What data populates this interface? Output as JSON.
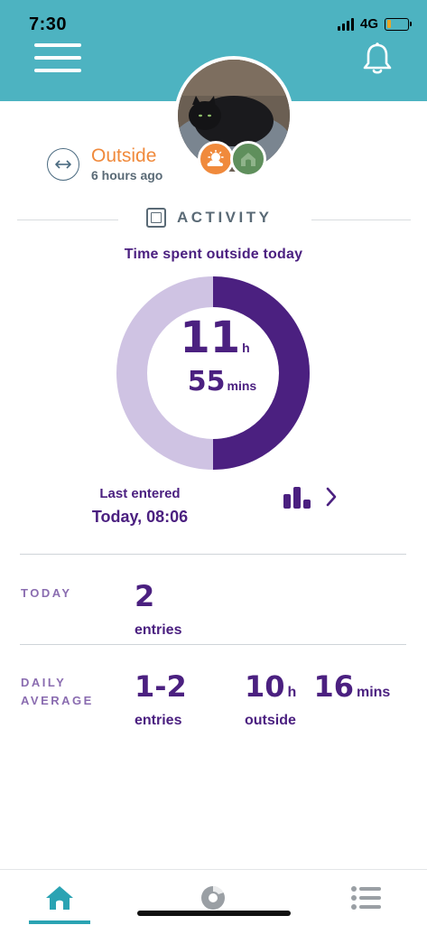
{
  "status_bar": {
    "time": "7:30",
    "network": "4G"
  },
  "pet": {
    "location_status": "Outside",
    "location_time": "6 hours ago"
  },
  "section": {
    "title": "ACTIVITY"
  },
  "chart": {
    "title": "Time spent outside today",
    "hours": "11",
    "hours_unit": "h",
    "minutes": "55",
    "minutes_unit": "mins",
    "progress_fraction": 0.5,
    "colors": {
      "progress": "#4b2080",
      "track": "#cfc3e3"
    }
  },
  "last_entered": {
    "label": "Last entered",
    "value": "Today, 08:06"
  },
  "today": {
    "label": "TODAY",
    "entries_value": "2",
    "entries_label": "entries"
  },
  "daily_average": {
    "label_line1": "DAILY",
    "label_line2": "AVERAGE",
    "entries_value": "1-2",
    "entries_label": "entries",
    "outside_hours": "10",
    "outside_hours_unit": "h",
    "outside_minutes": "16",
    "outside_minutes_unit": "mins",
    "outside_label": "outside"
  },
  "tabs": [
    {
      "name": "home",
      "icon": "home-icon",
      "active": true
    },
    {
      "name": "activity",
      "icon": "activity-dial-icon",
      "active": false
    },
    {
      "name": "list",
      "icon": "list-icon",
      "active": false
    }
  ],
  "colors": {
    "header": "#4db3c1",
    "accent": "#4b2080",
    "status_orange": "#f08a3c",
    "tab_active": "#2aa3b3"
  }
}
